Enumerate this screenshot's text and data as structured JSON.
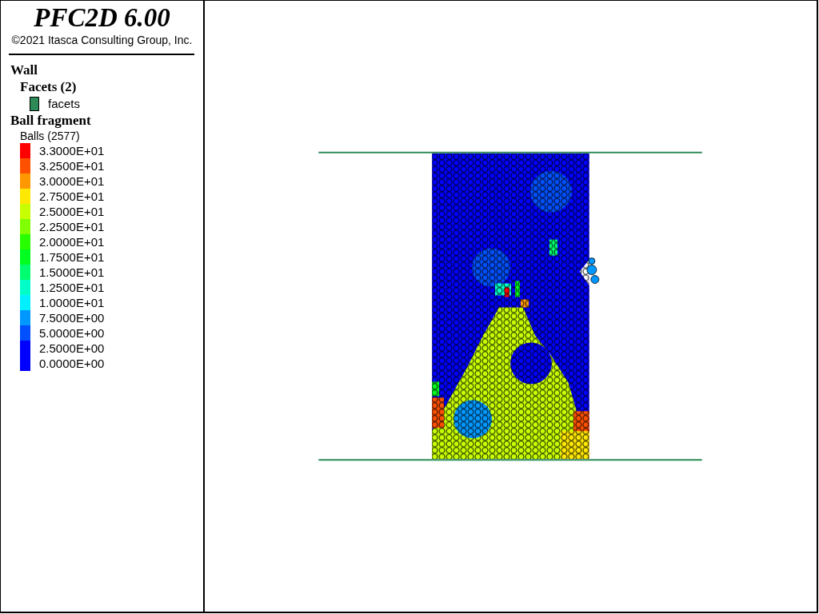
{
  "legend": {
    "title": "PFC2D 6.00",
    "copyright": "©2021 Itasca Consulting Group, Inc.",
    "groups": [
      {
        "heading": "Wall",
        "subheading": "Facets (2)",
        "kind": "swatch-list",
        "items": [
          {
            "label": "facets",
            "color": "#2e8b57"
          }
        ]
      },
      {
        "heading": "Ball fragment",
        "subheading": "Balls (2577)",
        "kind": "color-scale",
        "items": [
          {
            "label": "3.3000E+01",
            "color": "#ff0000"
          },
          {
            "label": "3.2500E+01",
            "color": "#ff5000"
          },
          {
            "label": "3.0000E+01",
            "color": "#ff9800"
          },
          {
            "label": "2.7500E+01",
            "color": "#ffe800"
          },
          {
            "label": "2.5000E+01",
            "color": "#c8ff00"
          },
          {
            "label": "2.2500E+01",
            "color": "#80ff00"
          },
          {
            "label": "2.0000E+01",
            "color": "#28ff00"
          },
          {
            "label": "1.7500E+01",
            "color": "#00ff20"
          },
          {
            "label": "1.5000E+01",
            "color": "#00ff70"
          },
          {
            "label": "1.2500E+01",
            "color": "#00ffc8"
          },
          {
            "label": "1.0000E+01",
            "color": "#00f0ff"
          },
          {
            "label": "7.5000E+00",
            "color": "#0098ff"
          },
          {
            "label": "5.0000E+00",
            "color": "#0050ff"
          },
          {
            "label": "2.5000E+00",
            "color": "#0000ff"
          },
          {
            "label": "0.0000E+00",
            "color": "#0000ff"
          }
        ]
      }
    ]
  }
}
